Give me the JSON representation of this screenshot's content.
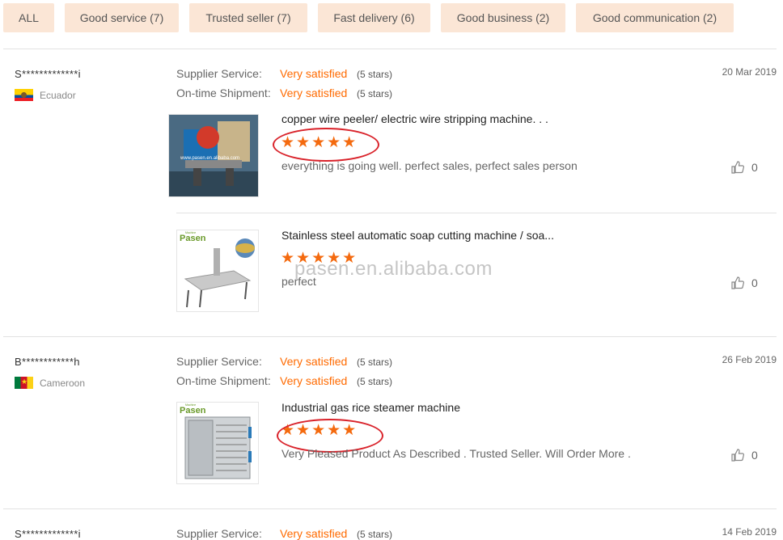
{
  "filters": [
    {
      "label": "ALL"
    },
    {
      "label": "Good service (7)"
    },
    {
      "label": "Trusted seller (7)"
    },
    {
      "label": "Fast delivery (6)"
    },
    {
      "label": "Good business (2)"
    },
    {
      "label": "Good communication (2)"
    }
  ],
  "labels": {
    "supplier_service": "Supplier Service:",
    "ontime_shipment": "On-time Shipment:"
  },
  "watermark": "pasen.en.alibaba.com",
  "reviews": [
    {
      "user": "S*************i",
      "country": "Ecuador",
      "date": "20 Mar 2019",
      "supplier_value": "Very satisfied",
      "supplier_stars": "(5 stars)",
      "shipment_value": "Very satisfied",
      "shipment_stars": "(5 stars)",
      "products": [
        {
          "title": "copper wire peeler/ electric wire stripping machine. . .",
          "stars": "★★★★★",
          "rating": 5,
          "comment": "everything is going well. perfect sales, perfect sales person",
          "likes": "0",
          "thumb_text": "www.pasen.en.alibaba.com"
        },
        {
          "title": "Stainless steel automatic soap cutting machine / soa...",
          "stars": "★★★★★",
          "rating": 5,
          "comment": "perfect",
          "likes": "0",
          "thumb_brand": "Pasen",
          "thumb_sub": "Machine"
        }
      ]
    },
    {
      "user": "B************h",
      "country": "Cameroon",
      "date": "26 Feb 2019",
      "supplier_value": "Very satisfied",
      "supplier_stars": "(5 stars)",
      "shipment_value": "Very satisfied",
      "shipment_stars": "(5 stars)",
      "products": [
        {
          "title": "Industrial gas rice steamer machine",
          "stars": "★★★★★",
          "rating": 5,
          "comment": "Very Pleased Product As Described . Trusted Seller. Will Order More .",
          "likes": "0",
          "thumb_brand": "Pasen",
          "thumb_sub": "Machine"
        }
      ]
    },
    {
      "user": "S*************i",
      "date": "14 Feb 2019",
      "supplier_value": "Very satisfied",
      "supplier_stars": "(5 stars)"
    }
  ],
  "colors": {
    "accent": "#ff6a00",
    "star": "#f46a0f",
    "chip_bg": "#fbe6d6",
    "circle": "#d9222a"
  }
}
